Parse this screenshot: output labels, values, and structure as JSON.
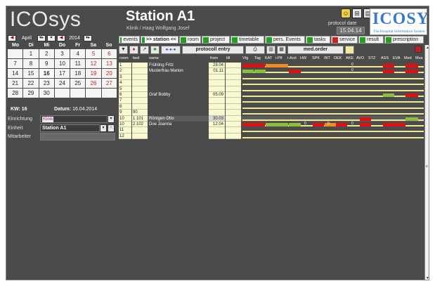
{
  "app": {
    "logo": "ICOsys"
  },
  "station": {
    "title": "Station A1",
    "subtitle": "Klinik / Haag Wolfgang Josef"
  },
  "protocol": {
    "label": "protocol date",
    "date": "15.04.14"
  },
  "brand": {
    "word": "ICOSYS",
    "tagline": "The Hospital Information System"
  },
  "calendar": {
    "month": "April",
    "year": "2014",
    "weekdays": [
      "Mo",
      "Di",
      "Mi",
      "Do",
      "Fr",
      "Sa",
      "So"
    ],
    "weeks": [
      [
        "",
        "1",
        "2",
        "3",
        "4",
        "5",
        "6"
      ],
      [
        "7",
        "8",
        "9",
        "10",
        "11",
        "12",
        "13"
      ],
      [
        "14",
        "15",
        "16",
        "17",
        "18",
        "19",
        "20"
      ],
      [
        "21",
        "22",
        "23",
        "24",
        "25",
        "26",
        "27"
      ],
      [
        "28",
        "29",
        "30",
        "",
        "",
        "",
        ""
      ]
    ],
    "today": "16"
  },
  "info": {
    "kw": "KW: 16",
    "datum_label": "Datum:",
    "datum_value": "16.04.2014",
    "einrichtung_label": "Einrichtung",
    "einrichtung_value": "Klinik",
    "einheit_label": "Einheit",
    "einheit_value": "Station A1",
    "mitarbeiter_label": "Mitarbeiter"
  },
  "tabs": [
    {
      "label": "events"
    },
    {
      "label": ">> station <<"
    },
    {
      "label": "room"
    },
    {
      "label": "project"
    },
    {
      "label": "timetable"
    },
    {
      "label": "pers. Events"
    },
    {
      "label": "tasks"
    },
    {
      "label": "service"
    },
    {
      "label": "result"
    },
    {
      "label": "prescription"
    }
  ],
  "toolbar": {
    "protocoll_entry": "protocoll entry",
    "med_order": "med.order"
  },
  "columns": {
    "room": "room",
    "bed": "bed",
    "name": "name",
    "from": "from",
    "till": "till",
    "status": [
      "Vtg",
      "Tag",
      "KAT",
      "i-Pfl",
      "i-Arzt",
      "HW",
      "SPK",
      "INT",
      "DEK",
      "AKE",
      "AVO",
      "STZ",
      "ASS",
      "EVA",
      "Med",
      "Mva"
    ]
  },
  "patients": [
    {
      "room": "1",
      "bed": "",
      "name": "Frühling Fritz",
      "from": "28.04",
      "till": ""
    },
    {
      "room": "2",
      "bed": "",
      "name": "Musterfrau Marion",
      "from": "01.11",
      "till": ""
    },
    {
      "room": "3",
      "bed": "",
      "name": "",
      "from": "",
      "till": ""
    },
    {
      "room": "4",
      "bed": "",
      "name": "",
      "from": "",
      "till": ""
    },
    {
      "room": "5",
      "bed": "",
      "name": "",
      "from": "",
      "till": ""
    },
    {
      "room": "6",
      "bed": "",
      "name": "Graf Bobby",
      "from": "05.09",
      "till": ""
    },
    {
      "room": "7",
      "bed": "",
      "name": "",
      "from": "",
      "till": ""
    },
    {
      "room": "8",
      "bed": "",
      "name": "",
      "from": "",
      "till": ""
    },
    {
      "room": "9",
      "bed": "90",
      "name": "",
      "from": "",
      "till": ""
    },
    {
      "room": "10",
      "bed": "1 101",
      "name": "Röntgen Otto",
      "from": "30.03",
      "till": ""
    },
    {
      "room": "10",
      "bed": "2 102",
      "name": "Doe Joanna",
      "from": "12.04",
      "till": ""
    },
    {
      "room": "11",
      "bed": "",
      "name": "",
      "from": "",
      "till": ""
    },
    {
      "room": "12",
      "bed": "",
      "name": "",
      "from": "",
      "till": ""
    }
  ],
  "cell_counts": [
    "0",
    "0",
    "0",
    "0",
    "0"
  ],
  "colors": {
    "red": "#e01010",
    "orange": "#f08c20",
    "green": "#8cc03a",
    "track": "#f0e890"
  }
}
